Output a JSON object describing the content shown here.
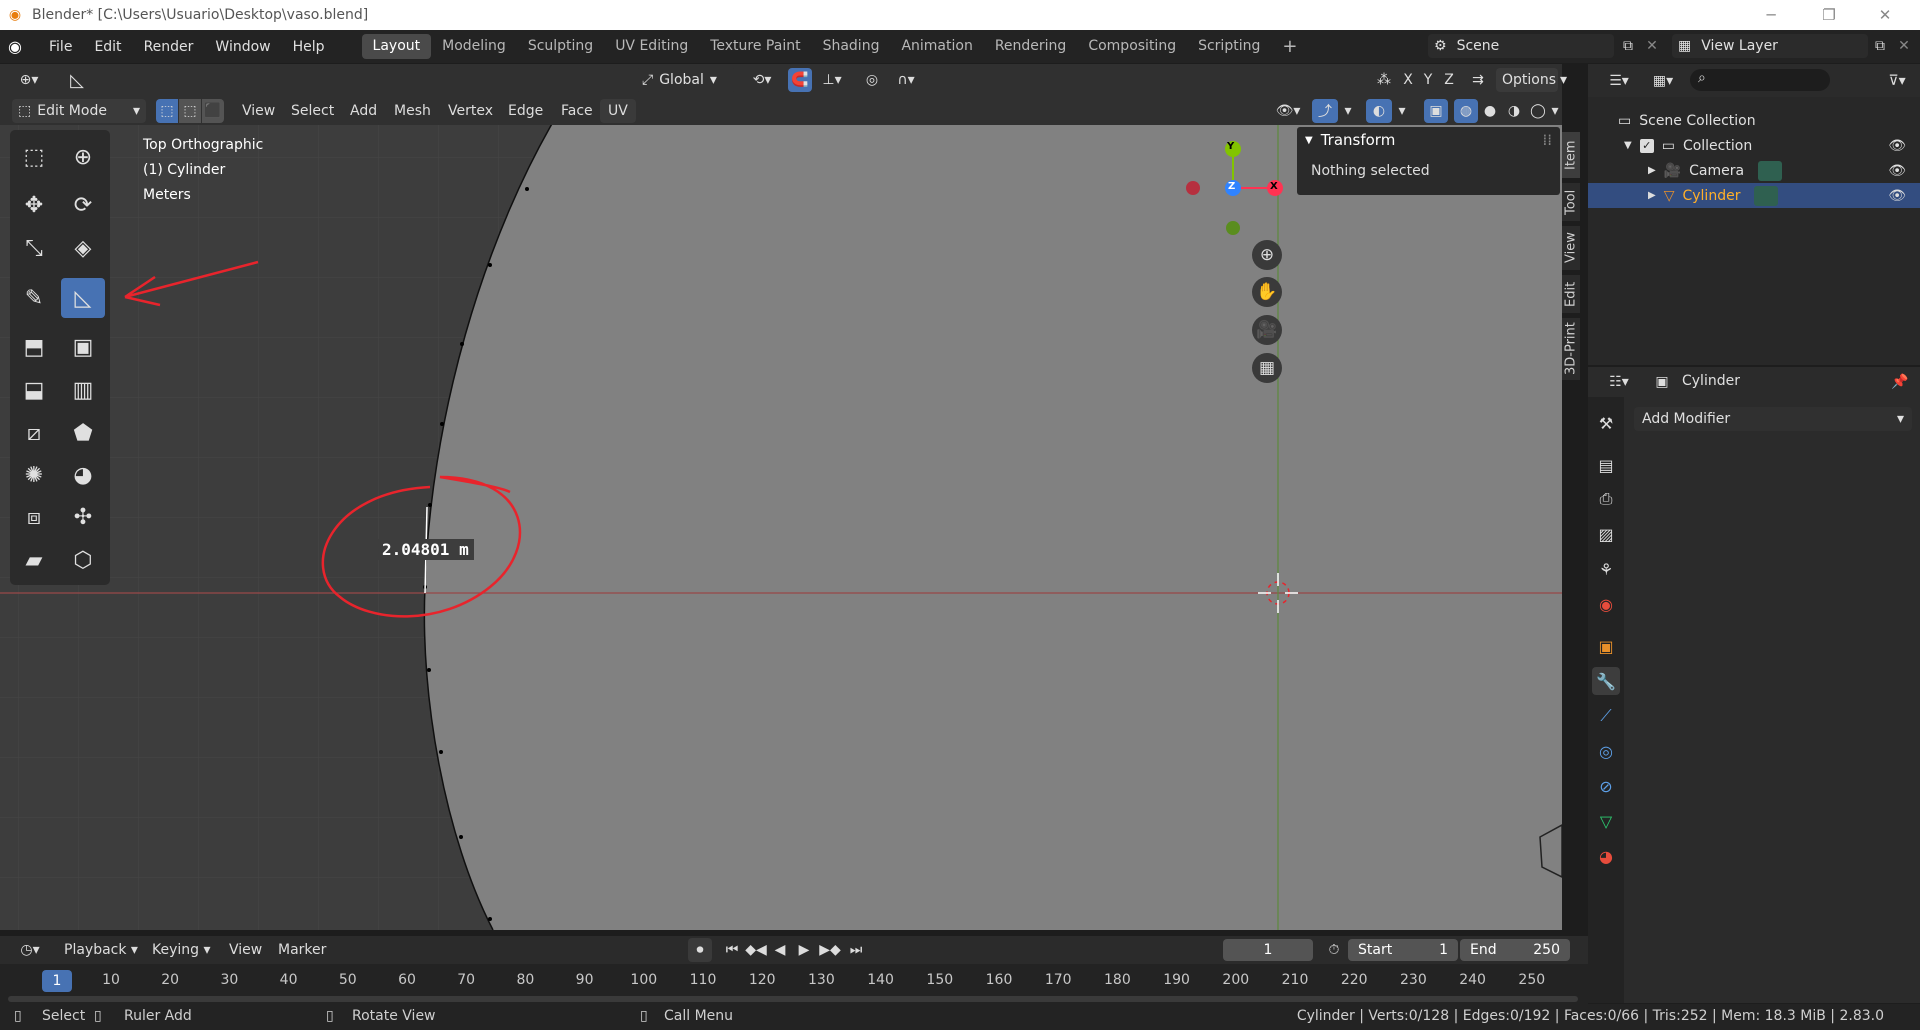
{
  "window": {
    "title": "Blender* [C:\\Users\\Usuario\\Desktop\\vaso.blend]"
  },
  "menus": [
    "File",
    "Edit",
    "Render",
    "Window",
    "Help"
  ],
  "workspaces": [
    "Layout",
    "Modeling",
    "Sculpting",
    "UV Editing",
    "Texture Paint",
    "Shading",
    "Animation",
    "Rendering",
    "Compositing",
    "Scripting"
  ],
  "scene": {
    "name": "Scene",
    "view_layer": "View Layer"
  },
  "viewport_header": {
    "orientation": "Global",
    "options": "Options",
    "axes": [
      "X",
      "Y",
      "Z"
    ]
  },
  "edit_header": {
    "mode": "Edit Mode",
    "menus": [
      "View",
      "Select",
      "Add",
      "Mesh",
      "Vertex",
      "Edge",
      "Face",
      "UV"
    ]
  },
  "overlay": {
    "view_name": "Top Orthographic",
    "object": "(1) Cylinder",
    "units": "Meters",
    "measure": "2.04801 m"
  },
  "gizmo": {
    "y": "Y",
    "z": "Z",
    "x": "X"
  },
  "n_panel": {
    "title": "Transform",
    "content": "Nothing selected",
    "tabs": [
      "Item",
      "Tool",
      "View",
      "Edit",
      "3D-Print"
    ]
  },
  "outliner": {
    "root": "Scene Collection",
    "collection": "Collection",
    "items": [
      "Camera",
      "Cylinder"
    ]
  },
  "properties": {
    "object": "Cylinder",
    "add_modifier": "Add Modifier"
  },
  "timeline": {
    "menus": [
      "Playback",
      "Keying",
      "View",
      "Marker"
    ],
    "current_frame": "1",
    "start_label": "Start",
    "start": "1",
    "end_label": "End",
    "end": "250",
    "ticks": [
      "10",
      "20",
      "30",
      "40",
      "50",
      "60",
      "70",
      "80",
      "90",
      "100",
      "110",
      "120",
      "130",
      "140",
      "150",
      "160",
      "170",
      "180",
      "190",
      "200",
      "210",
      "220",
      "230",
      "240",
      "250"
    ]
  },
  "statusbar": {
    "select": "Select",
    "ruler": "Ruler Add",
    "rotate": "Rotate View",
    "call_menu": "Call Menu",
    "stats": "Cylinder | Verts:0/128 | Edges:0/192 | Faces:0/66 | Tris:252 | Mem: 18.3 MiB | 2.83.0"
  },
  "colors": {
    "accent": "#4772b3",
    "annotation": "#e8242c",
    "mesh": "#818181",
    "bg": "#3d3d3d"
  }
}
